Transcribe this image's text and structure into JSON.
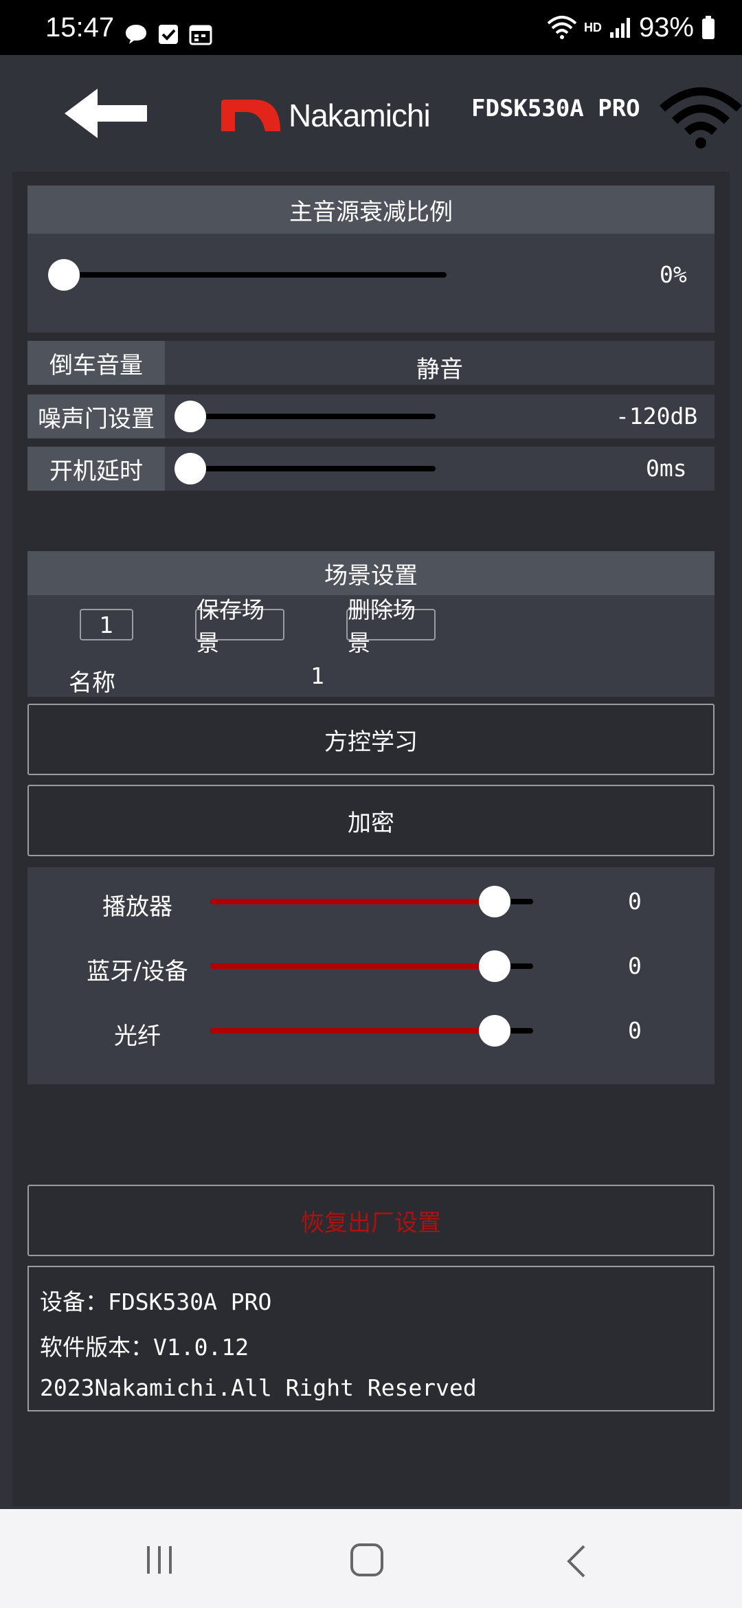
{
  "status_bar": {
    "time": "15:47",
    "battery": "93%",
    "network_label": "HD",
    "icons_left": [
      "chat-bubble-icon",
      "checkbox-icon",
      "calendar-icon"
    ],
    "icons_right": [
      "wifi-icon",
      "signal-icon",
      "battery-icon"
    ]
  },
  "header": {
    "brand": "Nakamichi",
    "model": "FDSK530A PRO",
    "back_icon": "arrow-left-icon",
    "connection_icon": "wifi-icon"
  },
  "main_attenuation": {
    "title": "主音源衰减比例",
    "value": "0%",
    "level": 0
  },
  "reverse_volume": {
    "label": "倒车音量",
    "value": "静音"
  },
  "noise_gate": {
    "label": "噪声门设置",
    "value": "-120dB",
    "level": 0
  },
  "power_delay": {
    "label": "开机延时",
    "value": "0ms",
    "level": 0
  },
  "scene": {
    "title": "场景设置",
    "selected": "1",
    "save_label": "保存场景",
    "delete_label": "删除场景",
    "name_label": "名称",
    "name_value": "1"
  },
  "buttons": {
    "steering_learn": "方控学习",
    "encrypt": "加密",
    "factory_reset": "恢复出厂设置"
  },
  "mixer": [
    {
      "label": "播放器",
      "value": "0",
      "level": 0.88
    },
    {
      "label": "蓝牙/设备",
      "value": "0",
      "level": 0.88
    },
    {
      "label": "光纤",
      "value": "0",
      "level": 0.88
    }
  ],
  "info": {
    "device": "设备：FDSK530A PRO",
    "version": "软件版本：V1.0.12",
    "copyright": "2023Nakamichi.All Right Reserved"
  },
  "nav_bar": {
    "icons": [
      "recent-apps-icon",
      "home-icon",
      "back-icon"
    ]
  },
  "colors": {
    "background": "#30333a",
    "panel": "#3a3d45",
    "panel_header": "#4f535c",
    "accent_red": "#b00000",
    "brand_red": "#e3241b",
    "reset_text": "#b01010"
  }
}
